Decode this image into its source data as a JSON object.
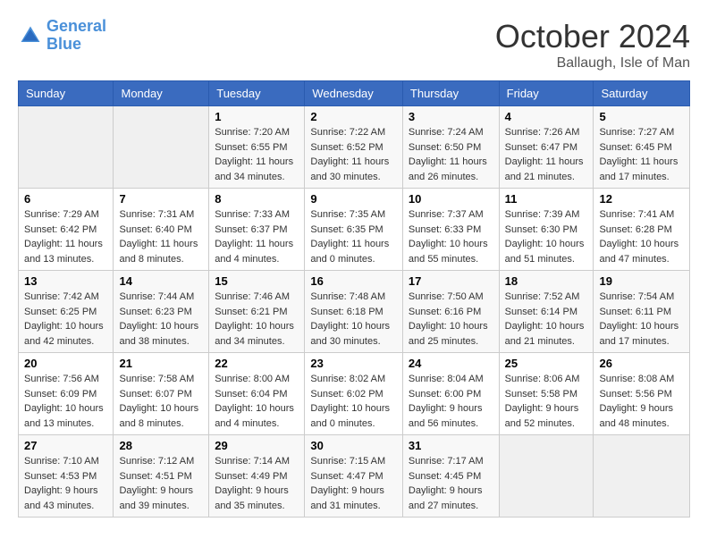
{
  "header": {
    "logo_line1": "General",
    "logo_line2": "Blue",
    "month": "October 2024",
    "location": "Ballaugh, Isle of Man"
  },
  "weekdays": [
    "Sunday",
    "Monday",
    "Tuesday",
    "Wednesday",
    "Thursday",
    "Friday",
    "Saturday"
  ],
  "weeks": [
    [
      {
        "day": "",
        "sunrise": "",
        "sunset": "",
        "daylight": ""
      },
      {
        "day": "",
        "sunrise": "",
        "sunset": "",
        "daylight": ""
      },
      {
        "day": "1",
        "sunrise": "Sunrise: 7:20 AM",
        "sunset": "Sunset: 6:55 PM",
        "daylight": "Daylight: 11 hours and 34 minutes."
      },
      {
        "day": "2",
        "sunrise": "Sunrise: 7:22 AM",
        "sunset": "Sunset: 6:52 PM",
        "daylight": "Daylight: 11 hours and 30 minutes."
      },
      {
        "day": "3",
        "sunrise": "Sunrise: 7:24 AM",
        "sunset": "Sunset: 6:50 PM",
        "daylight": "Daylight: 11 hours and 26 minutes."
      },
      {
        "day": "4",
        "sunrise": "Sunrise: 7:26 AM",
        "sunset": "Sunset: 6:47 PM",
        "daylight": "Daylight: 11 hours and 21 minutes."
      },
      {
        "day": "5",
        "sunrise": "Sunrise: 7:27 AM",
        "sunset": "Sunset: 6:45 PM",
        "daylight": "Daylight: 11 hours and 17 minutes."
      }
    ],
    [
      {
        "day": "6",
        "sunrise": "Sunrise: 7:29 AM",
        "sunset": "Sunset: 6:42 PM",
        "daylight": "Daylight: 11 hours and 13 minutes."
      },
      {
        "day": "7",
        "sunrise": "Sunrise: 7:31 AM",
        "sunset": "Sunset: 6:40 PM",
        "daylight": "Daylight: 11 hours and 8 minutes."
      },
      {
        "day": "8",
        "sunrise": "Sunrise: 7:33 AM",
        "sunset": "Sunset: 6:37 PM",
        "daylight": "Daylight: 11 hours and 4 minutes."
      },
      {
        "day": "9",
        "sunrise": "Sunrise: 7:35 AM",
        "sunset": "Sunset: 6:35 PM",
        "daylight": "Daylight: 11 hours and 0 minutes."
      },
      {
        "day": "10",
        "sunrise": "Sunrise: 7:37 AM",
        "sunset": "Sunset: 6:33 PM",
        "daylight": "Daylight: 10 hours and 55 minutes."
      },
      {
        "day": "11",
        "sunrise": "Sunrise: 7:39 AM",
        "sunset": "Sunset: 6:30 PM",
        "daylight": "Daylight: 10 hours and 51 minutes."
      },
      {
        "day": "12",
        "sunrise": "Sunrise: 7:41 AM",
        "sunset": "Sunset: 6:28 PM",
        "daylight": "Daylight: 10 hours and 47 minutes."
      }
    ],
    [
      {
        "day": "13",
        "sunrise": "Sunrise: 7:42 AM",
        "sunset": "Sunset: 6:25 PM",
        "daylight": "Daylight: 10 hours and 42 minutes."
      },
      {
        "day": "14",
        "sunrise": "Sunrise: 7:44 AM",
        "sunset": "Sunset: 6:23 PM",
        "daylight": "Daylight: 10 hours and 38 minutes."
      },
      {
        "day": "15",
        "sunrise": "Sunrise: 7:46 AM",
        "sunset": "Sunset: 6:21 PM",
        "daylight": "Daylight: 10 hours and 34 minutes."
      },
      {
        "day": "16",
        "sunrise": "Sunrise: 7:48 AM",
        "sunset": "Sunset: 6:18 PM",
        "daylight": "Daylight: 10 hours and 30 minutes."
      },
      {
        "day": "17",
        "sunrise": "Sunrise: 7:50 AM",
        "sunset": "Sunset: 6:16 PM",
        "daylight": "Daylight: 10 hours and 25 minutes."
      },
      {
        "day": "18",
        "sunrise": "Sunrise: 7:52 AM",
        "sunset": "Sunset: 6:14 PM",
        "daylight": "Daylight: 10 hours and 21 minutes."
      },
      {
        "day": "19",
        "sunrise": "Sunrise: 7:54 AM",
        "sunset": "Sunset: 6:11 PM",
        "daylight": "Daylight: 10 hours and 17 minutes."
      }
    ],
    [
      {
        "day": "20",
        "sunrise": "Sunrise: 7:56 AM",
        "sunset": "Sunset: 6:09 PM",
        "daylight": "Daylight: 10 hours and 13 minutes."
      },
      {
        "day": "21",
        "sunrise": "Sunrise: 7:58 AM",
        "sunset": "Sunset: 6:07 PM",
        "daylight": "Daylight: 10 hours and 8 minutes."
      },
      {
        "day": "22",
        "sunrise": "Sunrise: 8:00 AM",
        "sunset": "Sunset: 6:04 PM",
        "daylight": "Daylight: 10 hours and 4 minutes."
      },
      {
        "day": "23",
        "sunrise": "Sunrise: 8:02 AM",
        "sunset": "Sunset: 6:02 PM",
        "daylight": "Daylight: 10 hours and 0 minutes."
      },
      {
        "day": "24",
        "sunrise": "Sunrise: 8:04 AM",
        "sunset": "Sunset: 6:00 PM",
        "daylight": "Daylight: 9 hours and 56 minutes."
      },
      {
        "day": "25",
        "sunrise": "Sunrise: 8:06 AM",
        "sunset": "Sunset: 5:58 PM",
        "daylight": "Daylight: 9 hours and 52 minutes."
      },
      {
        "day": "26",
        "sunrise": "Sunrise: 8:08 AM",
        "sunset": "Sunset: 5:56 PM",
        "daylight": "Daylight: 9 hours and 48 minutes."
      }
    ],
    [
      {
        "day": "27",
        "sunrise": "Sunrise: 7:10 AM",
        "sunset": "Sunset: 4:53 PM",
        "daylight": "Daylight: 9 hours and 43 minutes."
      },
      {
        "day": "28",
        "sunrise": "Sunrise: 7:12 AM",
        "sunset": "Sunset: 4:51 PM",
        "daylight": "Daylight: 9 hours and 39 minutes."
      },
      {
        "day": "29",
        "sunrise": "Sunrise: 7:14 AM",
        "sunset": "Sunset: 4:49 PM",
        "daylight": "Daylight: 9 hours and 35 minutes."
      },
      {
        "day": "30",
        "sunrise": "Sunrise: 7:15 AM",
        "sunset": "Sunset: 4:47 PM",
        "daylight": "Daylight: 9 hours and 31 minutes."
      },
      {
        "day": "31",
        "sunrise": "Sunrise: 7:17 AM",
        "sunset": "Sunset: 4:45 PM",
        "daylight": "Daylight: 9 hours and 27 minutes."
      },
      {
        "day": "",
        "sunrise": "",
        "sunset": "",
        "daylight": ""
      },
      {
        "day": "",
        "sunrise": "",
        "sunset": "",
        "daylight": ""
      }
    ]
  ]
}
